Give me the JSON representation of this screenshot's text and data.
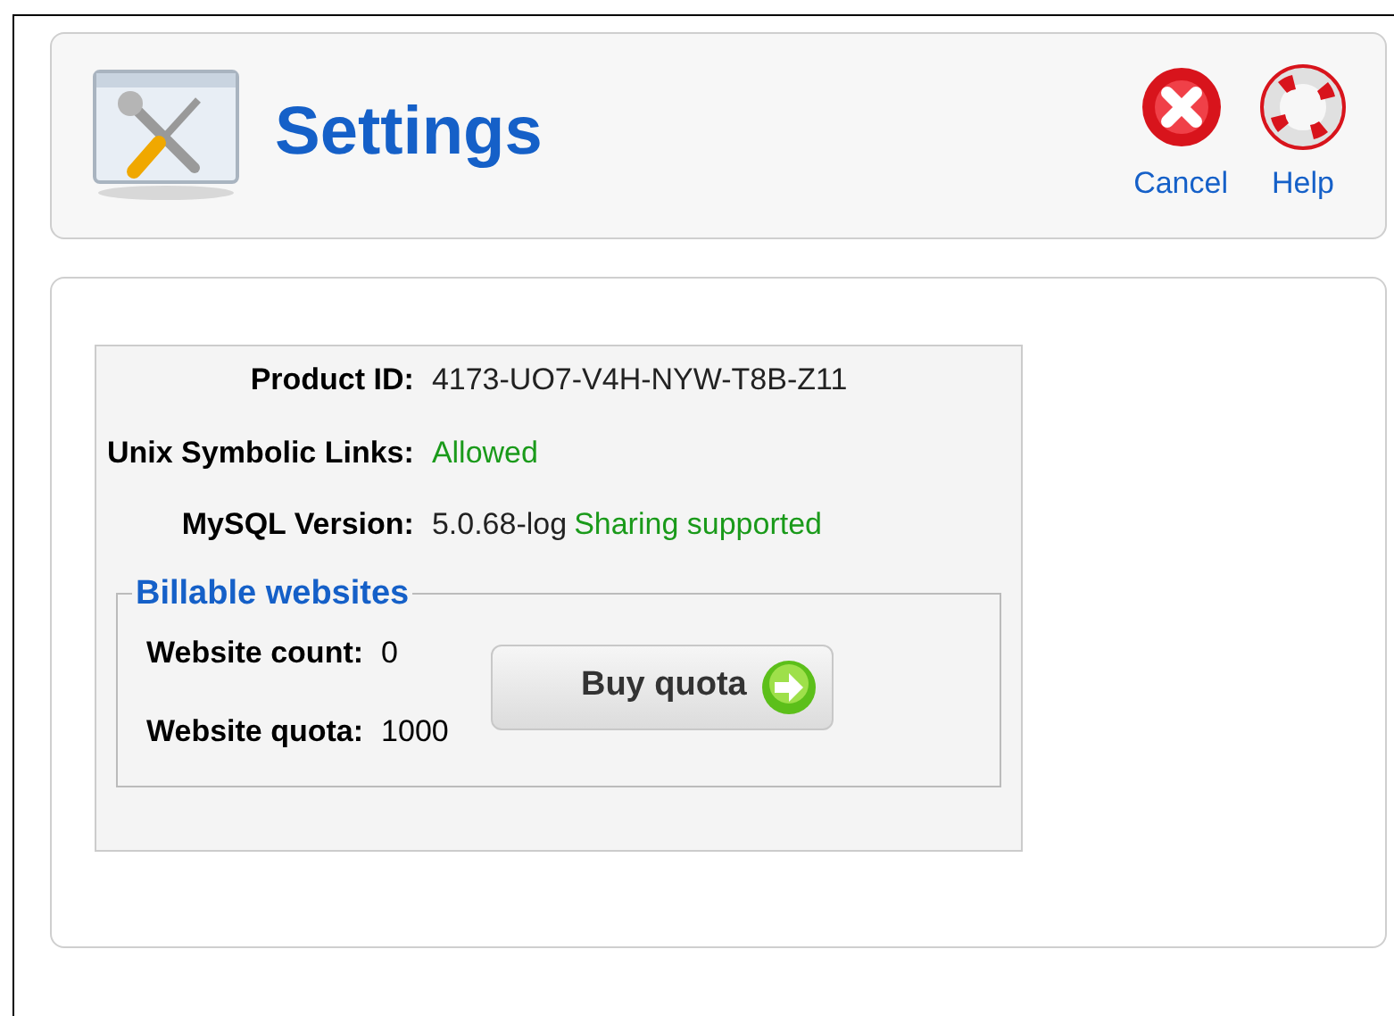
{
  "header": {
    "title": "Settings",
    "actions": [
      {
        "kind": "cancel",
        "label": "Cancel"
      },
      {
        "kind": "help",
        "label": "Help"
      }
    ]
  },
  "info": [
    {
      "label": "Product ID:",
      "parts": [
        {
          "kind": "plain",
          "text": "4173-UO7-V4H-NYW-T8B-Z11"
        }
      ]
    },
    {
      "label": "Unix Symbolic Links:",
      "parts": [
        {
          "kind": "ok",
          "text": "Allowed"
        }
      ]
    },
    {
      "label": "MySQL Version:",
      "parts": [
        {
          "kind": "plain",
          "text": "5.0.68-log"
        },
        {
          "kind": "ok",
          "text": "Sharing supported"
        }
      ]
    }
  ],
  "billable": {
    "legend": "Billable websites",
    "rows": [
      {
        "label": "Website count:",
        "value": "0"
      },
      {
        "label": "Website quota:",
        "value": "1000"
      }
    ],
    "button": "Buy quota"
  }
}
